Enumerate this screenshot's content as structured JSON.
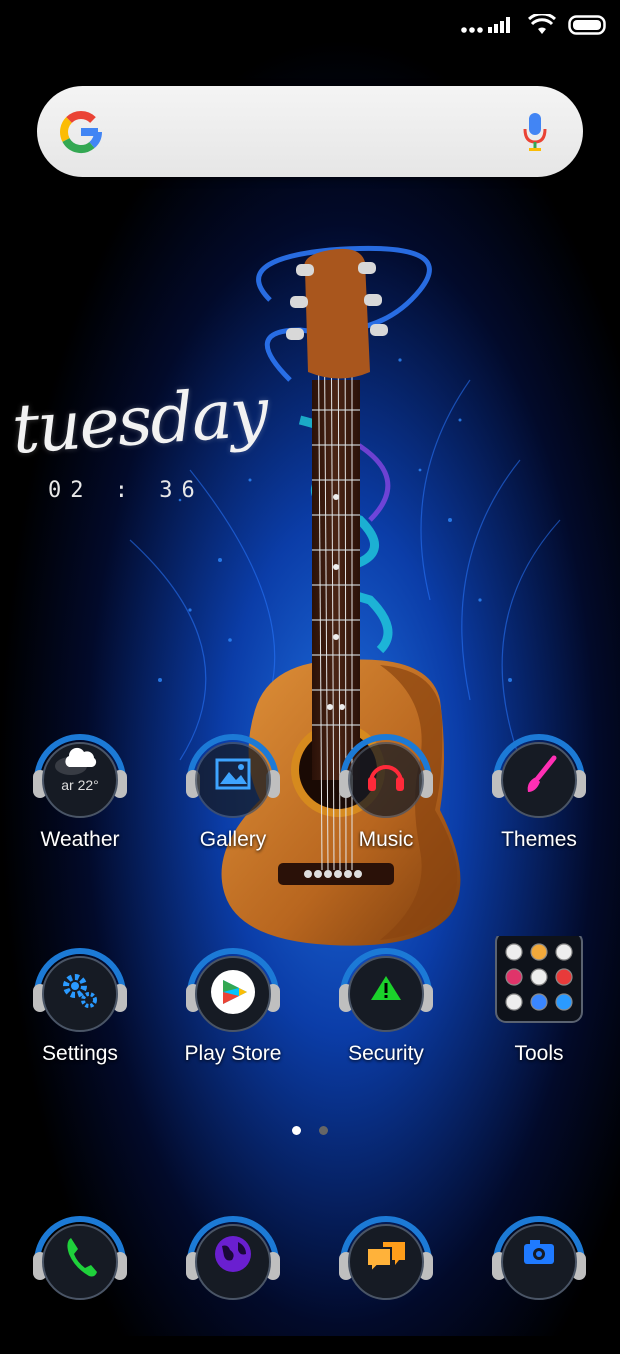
{
  "status": {
    "signal": "signal-icon",
    "wifi": "wifi-icon",
    "battery": "battery-icon"
  },
  "search": {
    "logo": "google-icon",
    "mic": "mic-icon"
  },
  "clock": {
    "day": "tuesday",
    "time": "02 : 36"
  },
  "apps": [
    {
      "label": "Weather",
      "icon": "weather-icon",
      "badge": "ar 22°"
    },
    {
      "label": "Gallery",
      "icon": "gallery-icon"
    },
    {
      "label": "Music",
      "icon": "headphones-icon"
    },
    {
      "label": "Themes",
      "icon": "brush-icon"
    },
    {
      "label": "Settings",
      "icon": "gear-icon"
    },
    {
      "label": "Play Store",
      "icon": "play-store-icon"
    },
    {
      "label": "Security",
      "icon": "warning-icon"
    },
    {
      "label": "Tools",
      "icon": "folder-icon"
    }
  ],
  "pager": {
    "pages": 2,
    "current": 1
  },
  "dock": [
    {
      "icon": "phone-icon"
    },
    {
      "icon": "browser-icon"
    },
    {
      "icon": "messages-icon"
    },
    {
      "icon": "camera-icon"
    }
  ],
  "colors": {
    "accent": "#1c7ad6",
    "guitar": "#b8661f",
    "glow": "#1a5fd0"
  }
}
